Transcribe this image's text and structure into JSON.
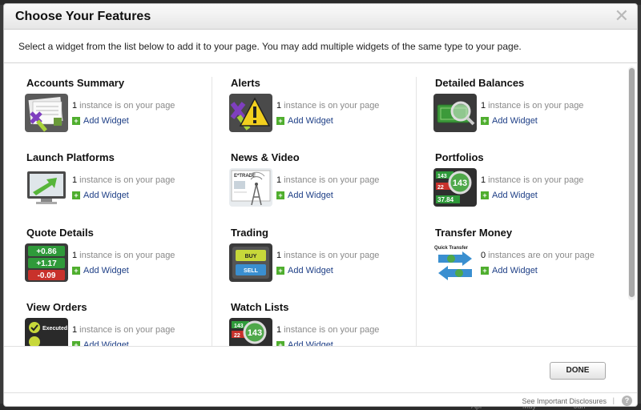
{
  "dialog": {
    "title": "Choose Your Features",
    "intro": "Select a widget from the list below to add it to your page. You may add multiple widgets of the same type to your page.",
    "done_label": "DONE",
    "disclosures_label": "See Important Disclosures",
    "separator": "|",
    "help_glyph": "?",
    "close_glyph": "✕"
  },
  "add_label": "Add Widget",
  "columns": [
    [
      {
        "title": "Accounts Summary",
        "count": "1",
        "count_text": " instance is on your page"
      },
      {
        "title": "Launch Platforms",
        "count": "1",
        "count_text": " instance is on your page"
      },
      {
        "title": "Quote Details",
        "count": "1",
        "count_text": " instance is on your page"
      },
      {
        "title": "View Orders",
        "count": "1",
        "count_text": " instance is on your page"
      }
    ],
    [
      {
        "title": "Alerts",
        "count": "1",
        "count_text": " instance is on your page"
      },
      {
        "title": "News & Video",
        "count": "1",
        "count_text": " instance is on your page"
      },
      {
        "title": "Trading",
        "count": "1",
        "count_text": " instance is on your page"
      },
      {
        "title": "Watch Lists",
        "count": "1",
        "count_text": " instance is on your page"
      }
    ],
    [
      {
        "title": "Detailed Balances",
        "count": "1",
        "count_text": " instance is on your page"
      },
      {
        "title": "Portfolios",
        "count": "1",
        "count_text": " instance is on your page"
      },
      {
        "title": "Transfer Money",
        "count": "0",
        "count_text": " instances are on your page"
      }
    ]
  ],
  "thumb_text": {
    "quote_values": [
      "+0.86",
      "+1.17",
      "-0.09"
    ],
    "portfolio_values": [
      "143",
      "22",
      "37.84"
    ],
    "watch_values": [
      "143",
      "22"
    ],
    "trade_buy": "BUY",
    "trade_sell": "SELL",
    "news_brand": "E*TRADE",
    "transfer_label": "Quick Transfer",
    "orders_label": "Executed"
  },
  "background": {
    "months": [
      "Apr",
      "May",
      "Jun"
    ]
  },
  "colors": {
    "accent_link": "#1e3f86",
    "plus_green": "#4fae2e"
  }
}
